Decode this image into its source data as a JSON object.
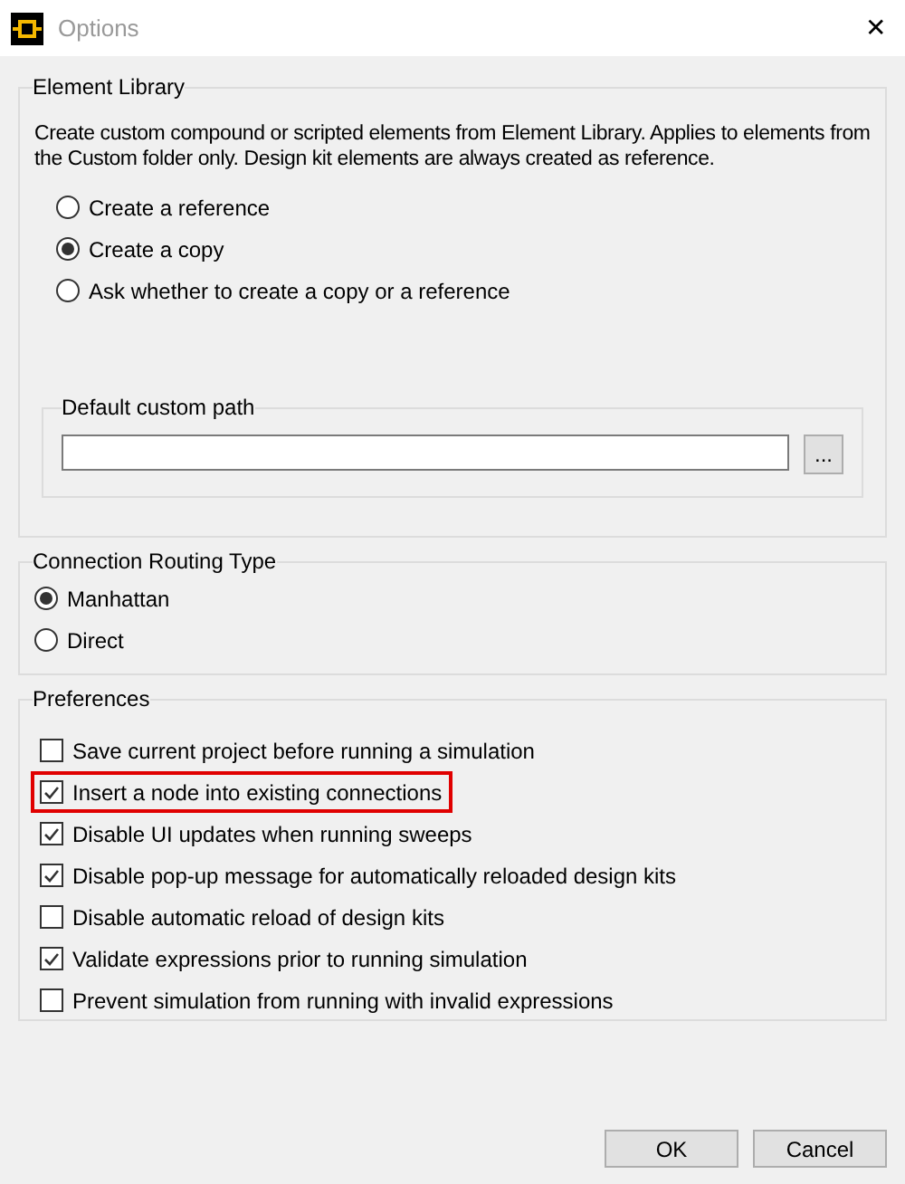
{
  "window": {
    "title": "Options",
    "close": "✕"
  },
  "element_library": {
    "title": "Element Library",
    "description": "Create custom compound or scripted elements from Element Library. Applies to elements from the Custom folder only. Design kit elements are always created as reference.",
    "options": [
      {
        "label": "Create a reference",
        "selected": false
      },
      {
        "label": "Create a copy",
        "selected": true
      },
      {
        "label": "Ask whether to create a copy or a reference",
        "selected": false
      }
    ],
    "default_path": {
      "title": "Default custom path",
      "browse": "..."
    }
  },
  "routing": {
    "title": "Connection Routing Type",
    "options": [
      {
        "label": "Manhattan",
        "selected": true
      },
      {
        "label": "Direct",
        "selected": false
      }
    ]
  },
  "preferences": {
    "title": "Preferences",
    "items": [
      {
        "label": "Save current project before running a simulation",
        "checked": false,
        "highlighted": false
      },
      {
        "label": "Insert a node into existing connections",
        "checked": true,
        "highlighted": true
      },
      {
        "label": "Disable UI updates when running sweeps",
        "checked": true,
        "highlighted": false
      },
      {
        "label": "Disable pop-up message for automatically reloaded design kits",
        "checked": true,
        "highlighted": false
      },
      {
        "label": "Disable automatic reload of design kits",
        "checked": false,
        "highlighted": false
      },
      {
        "label": "Validate expressions prior to running simulation",
        "checked": true,
        "highlighted": false
      },
      {
        "label": "Prevent simulation from running with invalid expressions",
        "checked": false,
        "highlighted": false
      }
    ]
  },
  "buttons": [
    "OK",
    "Cancel"
  ]
}
